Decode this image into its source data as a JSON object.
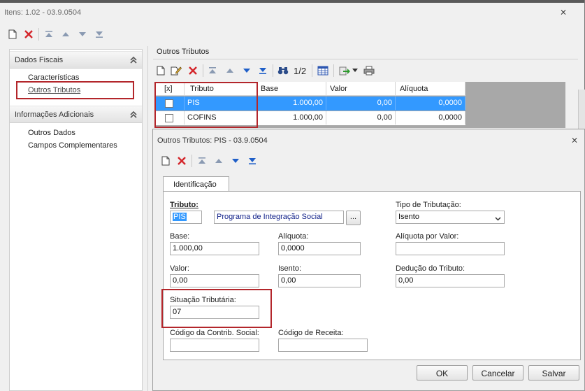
{
  "window": {
    "title": "Itens: 1.02 - 03.9.0504",
    "close_glyph": "⨯"
  },
  "sidebar": {
    "sections": [
      {
        "label": "Dados Fiscais",
        "items": [
          "Características",
          "Outros Tributos"
        ]
      },
      {
        "label": "Informações Adicionais",
        "items": [
          "Outros Dados",
          "Campos Complementares"
        ]
      }
    ]
  },
  "panel": {
    "title": "Outros Tributos",
    "pager": "1/2",
    "grid": {
      "headers": [
        "[x]",
        "Tributo",
        "Base",
        "Valor",
        "Alíquota"
      ],
      "rows": [
        {
          "tributo": "PIS",
          "base": "1.000,00",
          "valor": "0,00",
          "aliquota": "0,0000",
          "selected": true
        },
        {
          "tributo": "COFINS",
          "base": "1.000,00",
          "valor": "0,00",
          "aliquota": "0,0000",
          "selected": false
        }
      ]
    }
  },
  "dialog": {
    "title": "Outros Tributos: PIS - 03.9.0504",
    "tab": "Identificação",
    "fields": {
      "tributo_label": "Tributo:",
      "tributo_code": "PIS",
      "tributo_desc": "Programa de Integração Social",
      "lookup_btn": "...",
      "tipo_label": "Tipo de Tributação:",
      "tipo_value": "Isento",
      "base_label": "Base:",
      "base_value": "1.000,00",
      "aliquota_label": "Alíquota:",
      "aliquota_value": "0,0000",
      "aliq_valor_label": "Alíquota por Valor:",
      "aliq_valor_value": "",
      "valor_label": "Valor:",
      "valor_value": "0,00",
      "isento_label": "Isento:",
      "isento_value": "0,00",
      "deducao_label": "Dedução do Tributo:",
      "deducao_value": "0,00",
      "situacao_label": "Situação Tributária:",
      "situacao_value": "07",
      "codigo_contrib_label": "Código da Contrib. Social:",
      "codigo_contrib_value": "",
      "codigo_receita_label": "Código de Receita:",
      "codigo_receita_value": ""
    },
    "buttons": {
      "ok": "OK",
      "cancel": "Cancelar",
      "save": "Salvar"
    }
  },
  "colors": {
    "selection": "#3399ff",
    "highlight_box": "#b3262b",
    "link": "#0066cc"
  }
}
